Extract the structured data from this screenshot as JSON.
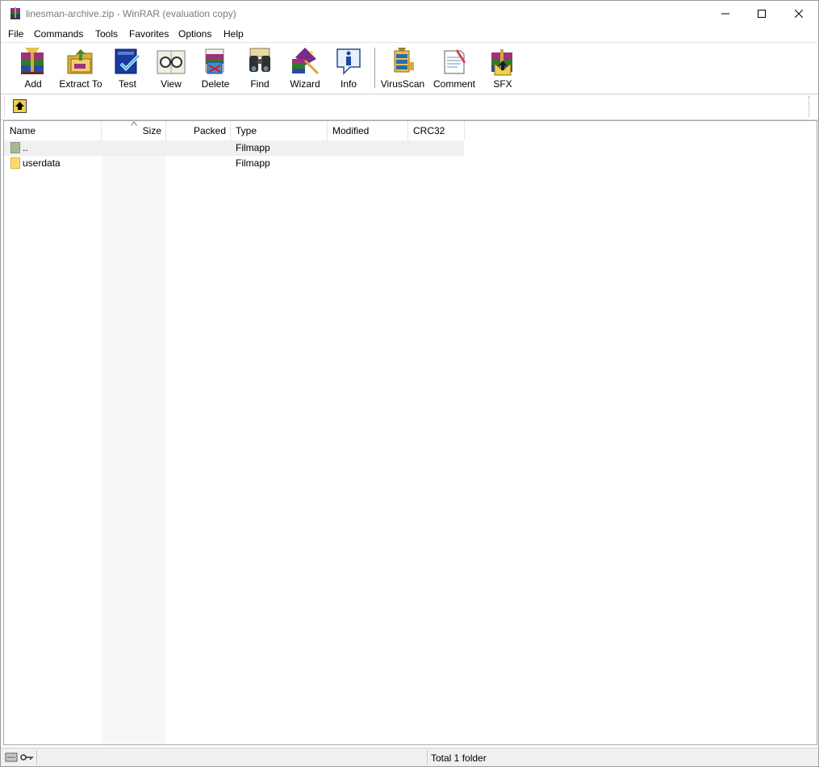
{
  "window": {
    "title": "linesman-archive.zip - WinRAR (evaluation copy)"
  },
  "menu": [
    "File",
    "Commands",
    "Tools",
    "Favorites",
    "Options",
    "Help"
  ],
  "toolbar": [
    {
      "id": "add",
      "label": "Add",
      "icon": "add-archive-icon"
    },
    {
      "id": "extract",
      "label": "Extract To",
      "icon": "extract-folder-icon"
    },
    {
      "id": "test",
      "label": "Test",
      "icon": "test-check-icon"
    },
    {
      "id": "view",
      "label": "View",
      "icon": "view-glasses-icon"
    },
    {
      "id": "delete",
      "label": "Delete",
      "icon": "delete-icon"
    },
    {
      "id": "find",
      "label": "Find",
      "icon": "binoculars-icon"
    },
    {
      "id": "wizard",
      "label": "Wizard",
      "icon": "wizard-icon"
    },
    {
      "id": "info",
      "label": "Info",
      "icon": "info-icon"
    },
    {
      "id": "virusscan",
      "label": "VirusScan",
      "icon": "virusscan-icon"
    },
    {
      "id": "comment",
      "label": "Comment",
      "icon": "comment-icon"
    },
    {
      "id": "sfx",
      "label": "SFX",
      "icon": "sfx-icon"
    }
  ],
  "addressbar": {
    "up_icon": "up-folder-icon"
  },
  "columns": [
    "Name",
    "Size",
    "Packed",
    "Type",
    "Modified",
    "CRC32"
  ],
  "files": [
    {
      "name": "..",
      "size": "",
      "packed": "",
      "type": "Filmapp",
      "modified": "",
      "crc32": "",
      "icon": "parent-folder-icon"
    },
    {
      "name": "userdata",
      "size": "",
      "packed": "",
      "type": "Filmapp",
      "modified": "",
      "crc32": "",
      "icon": "folder-icon"
    }
  ],
  "statusbar": {
    "left_text": "",
    "right_text": "Total 1 folder",
    "icons": "drive-key-icon"
  },
  "colors": {
    "selected_row": "#f0f0f0",
    "sort_column": "#f7f7f7",
    "title_text": "#7a7a7a",
    "folder": "#ffd96b"
  }
}
